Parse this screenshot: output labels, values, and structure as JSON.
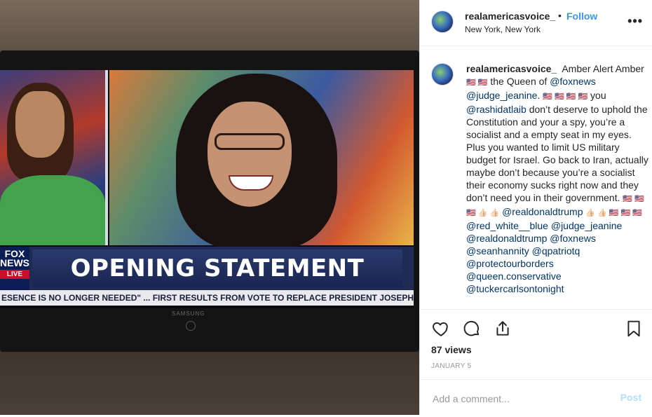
{
  "media": {
    "fox_logo_line1": "FOX",
    "fox_logo_line2": "NEWS",
    "fox_logo_live": "LIVE",
    "headline": "OPENING STATEMENT",
    "ticker": "ESENCE IS NO LONGER NEEDED\" ...   FIRST RESULTS FROM VOTE TO REPLACE PRESIDENT JOSEPH KABILA",
    "tv_brand": "SAMSUNG"
  },
  "header": {
    "username": "realamericasvoice_",
    "separator": "•",
    "follow_label": "Follow",
    "location": "New York, New York",
    "more_icon": "more-options-icon"
  },
  "caption": {
    "username": "realamericasvoice_",
    "parts": [
      {
        "type": "text",
        "value": "Amber Alert Amber "
      },
      {
        "type": "emoji",
        "value": "🇺🇸 🇺🇸"
      },
      {
        "type": "text",
        "value": " the Queen of "
      },
      {
        "type": "mention",
        "value": "@foxnews"
      },
      {
        "type": "text",
        "value": " "
      },
      {
        "type": "mention",
        "value": "@judge_jeanine"
      },
      {
        "type": "text",
        "value": ". "
      },
      {
        "type": "emoji",
        "value": "🇺🇸 🇺🇸 🇺🇸 🇺🇸"
      },
      {
        "type": "text",
        "value": "  you "
      },
      {
        "type": "mention",
        "value": "@rashidatlaib"
      },
      {
        "type": "text",
        "value": " don’t deserve to uphold the Constitution and your a spy, you’re a socialist and a empty seat in my eyes. Plus you wanted to limit US military budget for Israel. Go back to Iran, actually maybe don’t because you’re a socialist their economy sucks right now and they don’t need you in their government. "
      },
      {
        "type": "emoji",
        "value": "🇺🇸 🇺🇸 🇺🇸 👍🏻 👍🏻"
      },
      {
        "type": "text",
        "value": " "
      },
      {
        "type": "mention",
        "value": "@realdonaldtrump"
      },
      {
        "type": "text",
        "value": " "
      },
      {
        "type": "emoji",
        "value": "👍🏻 👍🏻 🇺🇸 🇺🇸 🇺🇸"
      },
      {
        "type": "text",
        "value": " "
      },
      {
        "type": "mention",
        "value": "@red_white__blue"
      },
      {
        "type": "text",
        "value": " "
      },
      {
        "type": "mention",
        "value": "@judge_jeanine"
      },
      {
        "type": "text",
        "value": " "
      },
      {
        "type": "mention",
        "value": "@realdonaldtrump"
      },
      {
        "type": "text",
        "value": " "
      },
      {
        "type": "mention",
        "value": "@foxnews"
      },
      {
        "type": "text",
        "value": " "
      },
      {
        "type": "mention",
        "value": "@seanhannity"
      },
      {
        "type": "text",
        "value": " "
      },
      {
        "type": "mention",
        "value": "@qpatriotq"
      },
      {
        "type": "text",
        "value": " "
      },
      {
        "type": "mention",
        "value": "@protectourborders"
      },
      {
        "type": "text",
        "value": " "
      },
      {
        "type": "mention",
        "value": "@queen.conservative"
      },
      {
        "type": "text",
        "value": " "
      },
      {
        "type": "mention",
        "value": "@tuckercarlsontonight"
      }
    ]
  },
  "actions": {
    "like_icon": "heart-icon",
    "comment_icon": "comment-bubble-icon",
    "share_icon": "share-icon",
    "save_icon": "bookmark-icon",
    "views": "87 views",
    "date": "JANUARY 5"
  },
  "comment_bar": {
    "placeholder": "Add a comment...",
    "post_label": "Post"
  },
  "colors": {
    "link": "#003569",
    "follow": "#3897f0",
    "post_disabled": "#b2dffc",
    "muted": "#999999"
  }
}
